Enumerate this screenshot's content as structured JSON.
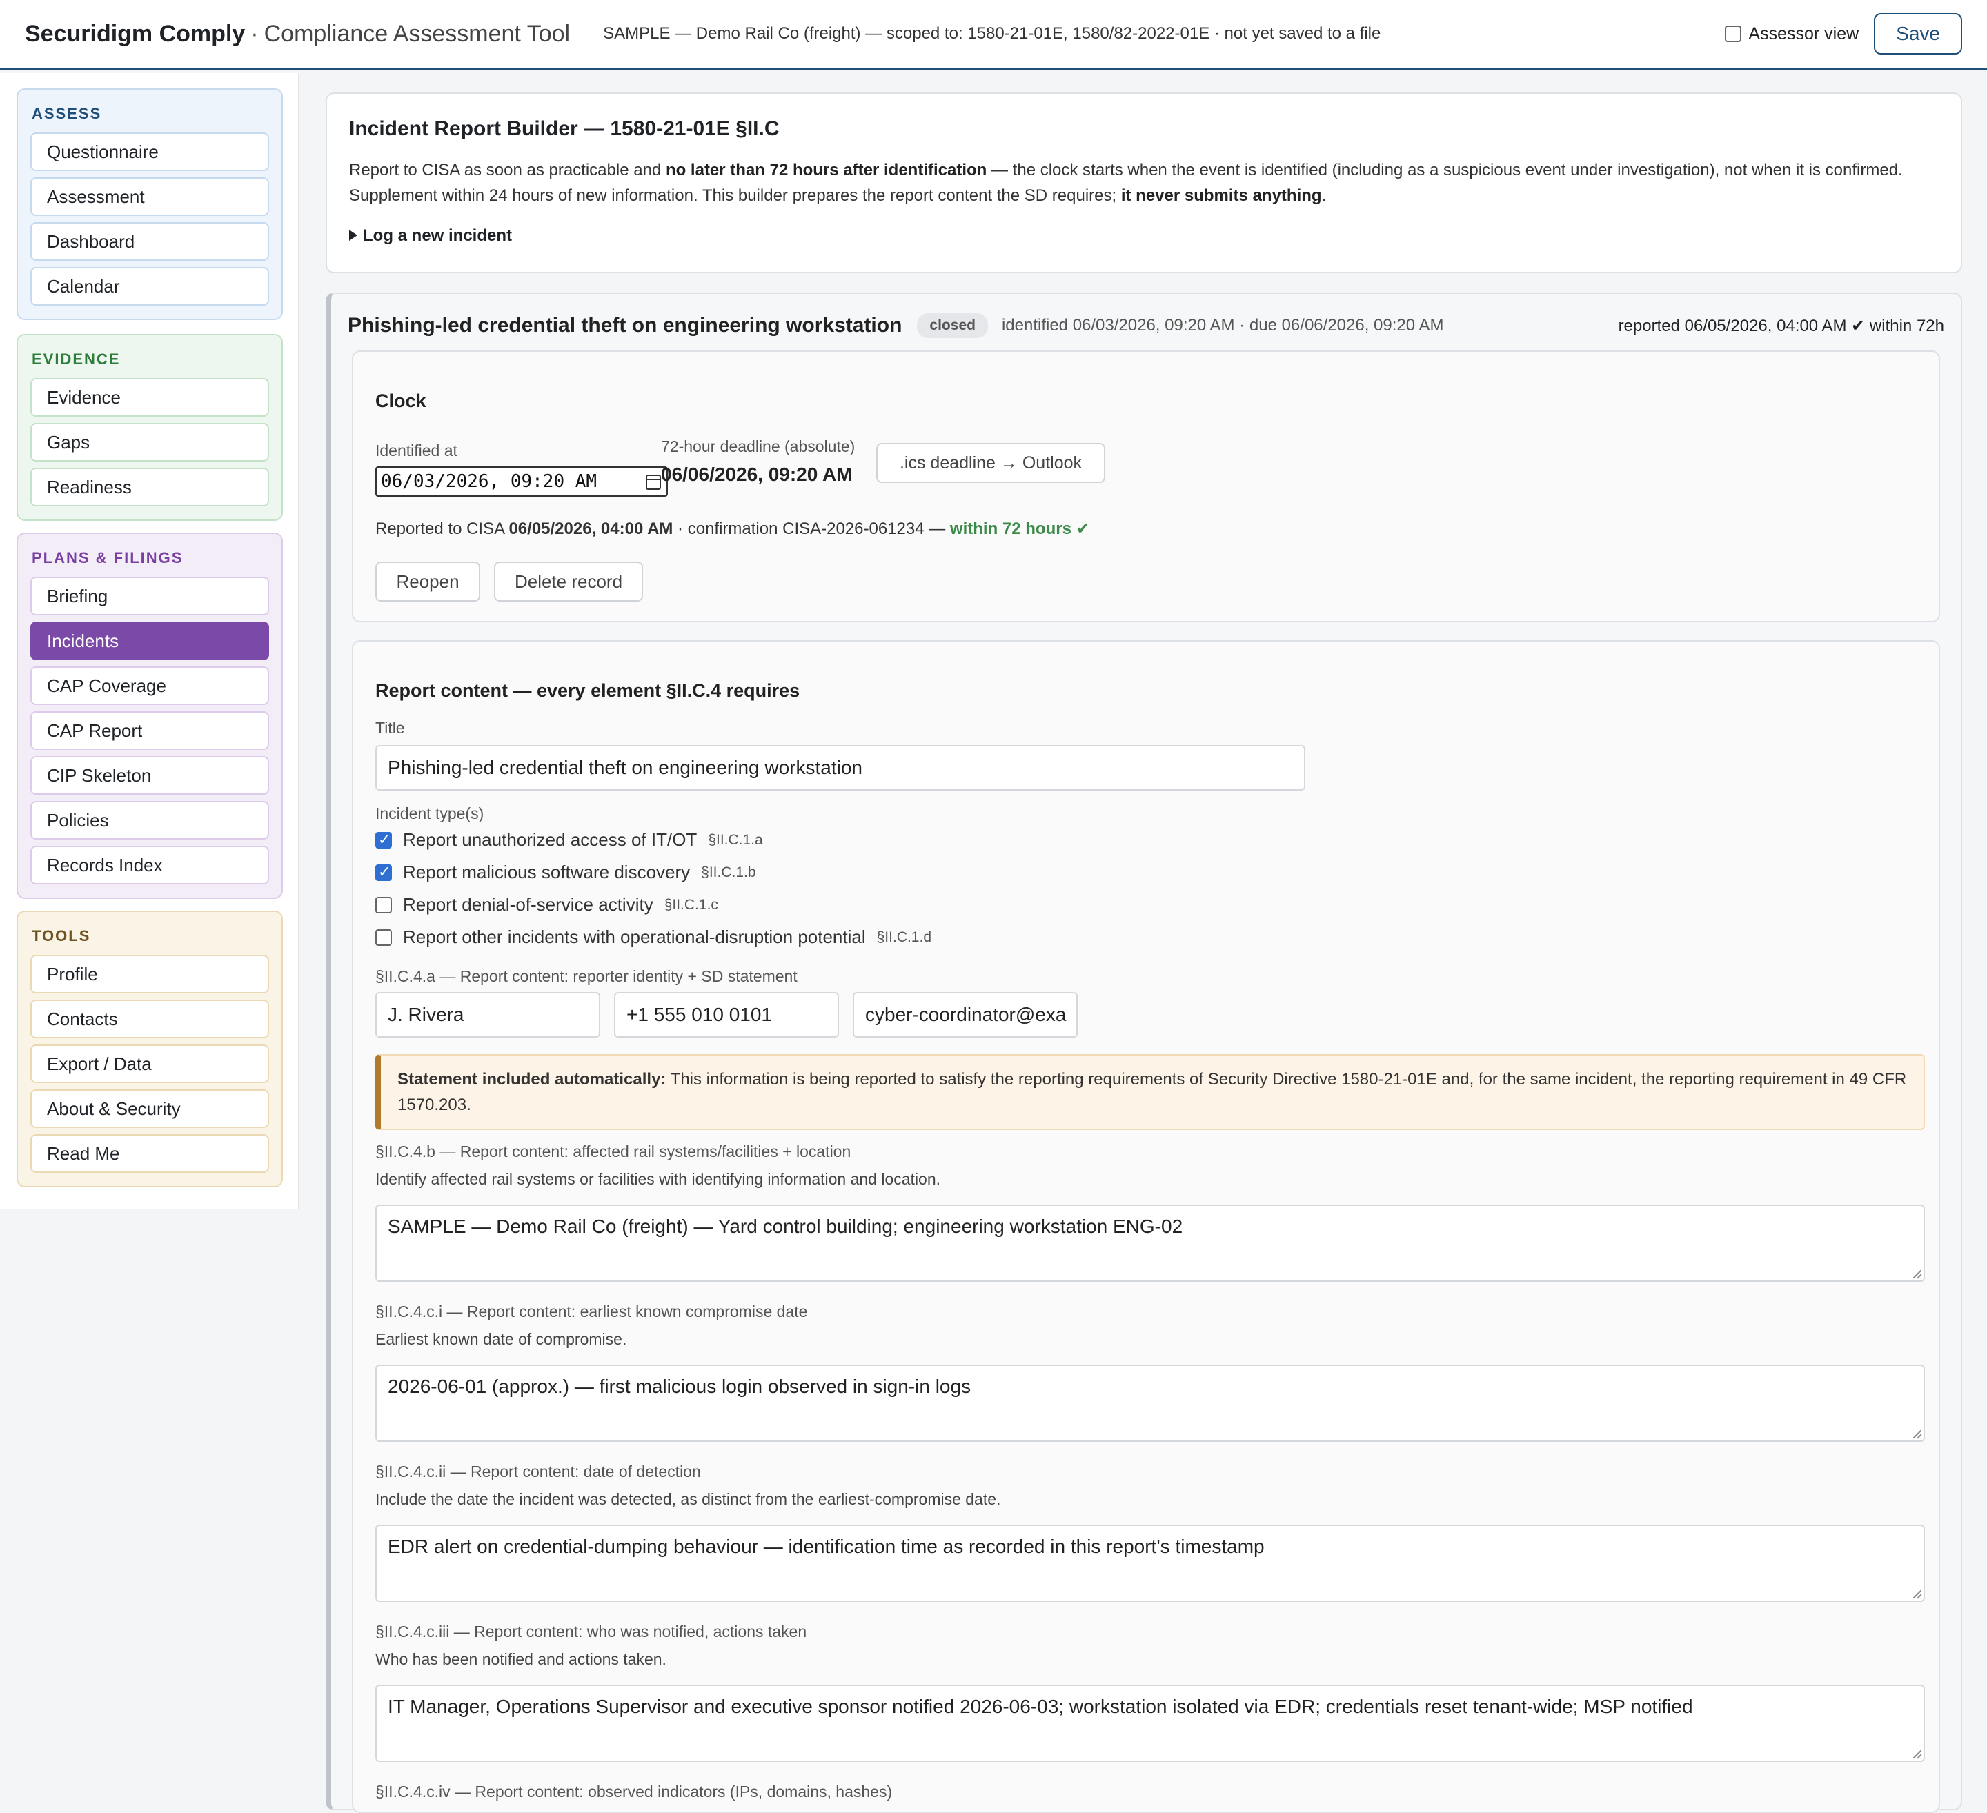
{
  "header": {
    "brand": "Securidigm Comply",
    "separator": "·",
    "subtitle": "Compliance Assessment Tool",
    "scope": "SAMPLE — Demo Rail Co (freight) — scoped to: 1580-21-01E, 1580/82-2022-01E · not yet saved to a file",
    "assessor_label": "Assessor view",
    "assessor_checked": false,
    "save_label": "Save"
  },
  "sidebar": {
    "groups": [
      {
        "title": "ASSESS",
        "items": [
          "Questionnaire",
          "Assessment",
          "Dashboard",
          "Calendar"
        ]
      },
      {
        "title": "EVIDENCE",
        "items": [
          "Evidence",
          "Gaps",
          "Readiness"
        ]
      },
      {
        "title": "PLANS & FILINGS",
        "items": [
          "Briefing",
          "Incidents",
          "CAP Coverage",
          "CAP Report",
          "CIP Skeleton",
          "Policies",
          "Records Index"
        ],
        "active": "Incidents"
      },
      {
        "title": "TOOLS",
        "items": [
          "Profile",
          "Contacts",
          "Export / Data",
          "About & Security",
          "Read Me"
        ]
      }
    ]
  },
  "intro": {
    "title": "Incident Report Builder — 1580-21-01E §II.C",
    "p1_a": "Report to CISA as soon as practicable and ",
    "p1_b": "no later than 72 hours after identification",
    "p1_c": " — the clock starts when the event is identified (including as a suspicious event under investigation), not when it is confirmed.",
    "p2_a": "Supplement within 24 hours of new information. This builder prepares the report content the SD requires; ",
    "p2_b": "it never submits anything",
    "p2_c": ".",
    "log_new": "Log a new incident"
  },
  "incident": {
    "title": "Phishing-led credential theft on engineering workstation",
    "status": "closed",
    "dates": "identified 06/03/2026, 09:20 AM · due 06/06/2026, 09:20 AM",
    "reported": "reported 06/05/2026, 04:00 AM ✔ within 72h",
    "clock": {
      "title": "Clock",
      "identified_label": "Identified at",
      "identified_value": "06/03/2026, 09:20 AM",
      "deadline_label": "72-hour deadline (absolute)",
      "deadline_value": "06/06/2026, 09:20 AM",
      "ics_label": ".ics deadline → Outlook",
      "reported_prefix": "Reported to CISA ",
      "reported_time": "06/05/2026, 04:00 AM",
      "reported_mid": " · confirmation CISA-2026-061234 — ",
      "reported_ok": "within 72 hours ✔",
      "reopen_label": "Reopen",
      "delete_label": "Delete record"
    },
    "report": {
      "title": "Report content — every element §II.C.4 requires",
      "title_label": "Title",
      "title_value": "Phishing-led credential theft on engineering workstation",
      "types_label": "Incident type(s)",
      "types": [
        {
          "label": "Report unauthorized access of IT/OT",
          "ref": "§II.C.1.a",
          "checked": true
        },
        {
          "label": "Report malicious software discovery",
          "ref": "§II.C.1.b",
          "checked": true
        },
        {
          "label": "Report denial-of-service activity",
          "ref": "§II.C.1.c",
          "checked": false
        },
        {
          "label": "Report other incidents with operational-disruption potential",
          "ref": "§II.C.1.d",
          "checked": false
        }
      ],
      "reporter_label": "§II.C.4.a — Report content: reporter identity + SD statement",
      "reporter_name": "J. Rivera",
      "reporter_phone": "+1 555 010 0101",
      "reporter_email": "cyber-coordinator@exa",
      "statement_bold": "Statement included automatically:",
      "statement_text": " This information is being reported to satisfy the reporting requirements of Security Directive 1580-21-01E and, for the same incident, the reporting requirement in 49 CFR 1570.203.",
      "b_label": "§II.C.4.b — Report content: affected rail systems/facilities + location",
      "b_hint": "Identify affected rail systems or facilities with identifying information and location.",
      "b_value": "SAMPLE — Demo Rail Co (freight) — Yard control building; engineering workstation ENG-02",
      "ci_label": "§II.C.4.c.i — Report content: earliest known compromise date",
      "ci_hint": "Earliest known date of compromise.",
      "ci_value": "2026-06-01 (approx.) — first malicious login observed in sign-in logs",
      "cii_label": "§II.C.4.c.ii — Report content: date of detection",
      "cii_hint": "Include the date the incident was detected, as distinct from the earliest-compromise date.",
      "cii_value": "EDR alert on credential-dumping behaviour — identification time as recorded in this report's timestamp",
      "ciii_label": "§II.C.4.c.iii — Report content: who was notified, actions taken",
      "ciii_hint": "Who has been notified and actions taken.",
      "ciii_value": "IT Manager, Operations Supervisor and executive sponsor notified 2026-06-03; workstation isolated via EDR; credentials reset tenant-wide; MSP notified",
      "civ_label": "§II.C.4.c.iv — Report content: observed indicators (IPs, domains, hashes)"
    }
  }
}
